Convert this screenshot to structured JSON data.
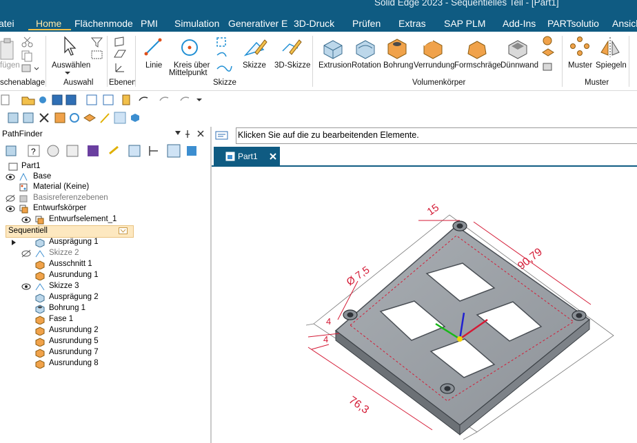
{
  "window": {
    "title": "Solid Edge 2023 - Sequentielles Teil - [Part1]"
  },
  "menu": {
    "items": [
      "atei",
      "Home",
      "Flächenmode",
      "PMI",
      "Simulation",
      "Generativer E",
      "3D-Druck",
      "Prüfen",
      "Extras",
      "SAP PLM",
      "Add-Ins",
      "PARTsolutio",
      "Ansich"
    ],
    "active": "Home"
  },
  "ribbon": {
    "fuegen": "fügen",
    "auswaehlen": "Auswählen",
    "linie": "Linie",
    "kreis_line1": "Kreis über",
    "kreis_line2": "Mittelpunkt",
    "skizze": "Skizze",
    "skizze3d": "3D-Skizze",
    "extrusion": "Extrusion",
    "rotation": "Rotation",
    "bohrung": "Bohrung",
    "verrundung": "Verrundung",
    "formschraege": "Formschräge",
    "duennwand": "Dünnwand",
    "muster": "Muster",
    "spiegeln": "Spiegeln",
    "groups": {
      "zwischenablage": "schenablage",
      "auswahl": "Auswahl",
      "ebenen": "Ebenen",
      "skizze": "Skizze",
      "volumen": "Volumenkörper",
      "muster": "Muster"
    }
  },
  "pathfinder": {
    "title": "PathFinder",
    "tree": {
      "part": "Part1",
      "base": "Base",
      "material": "Material (Keine)",
      "basisref": "Basisreferenzebenen",
      "entwurfskoerper": "Entwurfskörper",
      "entwurfselement": "Entwurfselement_1",
      "sequentiell": "Sequentiell",
      "features": [
        "Ausprägung 1",
        "Skizze 2",
        "Ausschnitt 1",
        "Ausrundung 1",
        "Skizze 3",
        "Ausprägung 2",
        "Bohrung 1",
        "Fase 1",
        "Ausrundung 2",
        "Ausrundung 5",
        "Ausrundung 7",
        "Ausrundung 8"
      ]
    }
  },
  "prompt": {
    "text": "Klicken Sie auf die zu bearbeitenden Elemente."
  },
  "doc_tab": {
    "label": "Part1"
  },
  "dimensions": {
    "d1": "15",
    "d2": "90,79",
    "d3": "Ø 7,5",
    "d4": "4",
    "d5": "4",
    "d6": "76,3"
  },
  "colors": {
    "titlebar": "#0f5b82",
    "sequentiell_bg": "#fde8c0",
    "dimension": "#d41a35"
  }
}
